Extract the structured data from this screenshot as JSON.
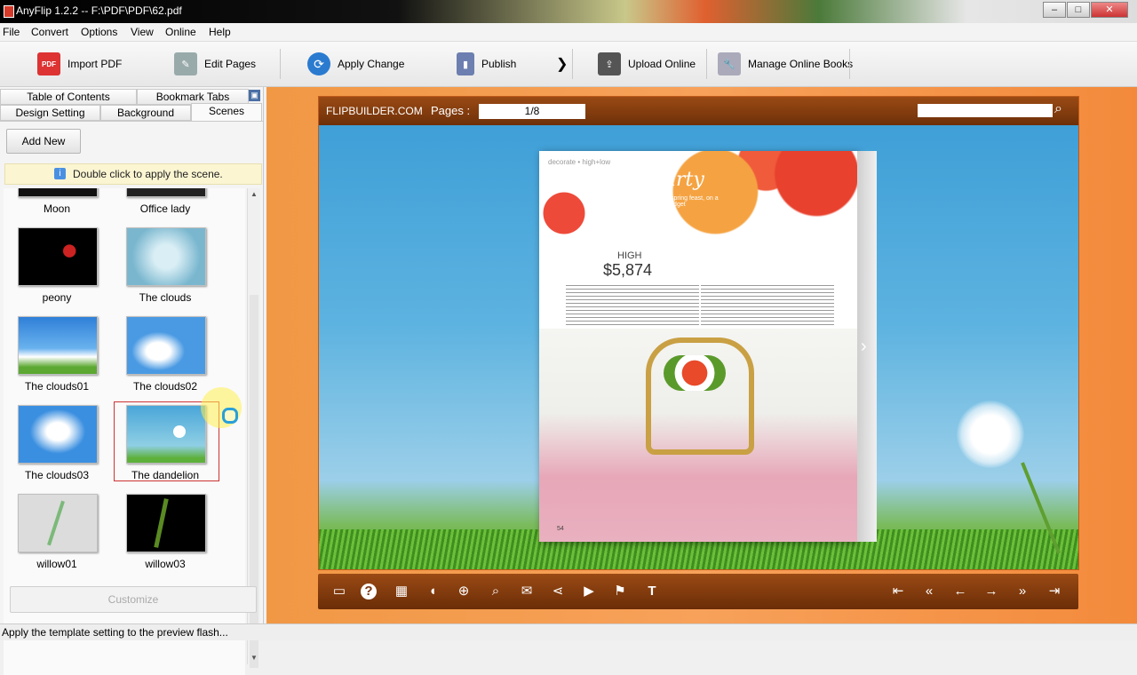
{
  "window": {
    "title": "AnyFlip 1.2.2  -- F:\\PDF\\PDF\\62.pdf",
    "min": "–",
    "max": "□",
    "close": "✕"
  },
  "menu": [
    "File",
    "Convert",
    "Options",
    "View",
    "Online",
    "Help"
  ],
  "toolbar": {
    "import_pdf": "Import PDF",
    "edit_pages": "Edit Pages",
    "apply_change": "Apply Change",
    "publish": "Publish",
    "more": "❯",
    "upload_online": "Upload Online",
    "manage_online_books": "Manage Online Books"
  },
  "left_panel": {
    "tabs_row1": [
      "Table of Contents",
      "Bookmark Tabs"
    ],
    "tabs_row2": [
      "Design Setting",
      "Background",
      "Scenes"
    ],
    "active_tab": "Scenes",
    "add_new": "Add New",
    "hint": "Double click to apply the scene.",
    "scenes": [
      {
        "label": "Moon"
      },
      {
        "label": "Office lady"
      },
      {
        "label": "peony"
      },
      {
        "label": "The clouds"
      },
      {
        "label": "The clouds01"
      },
      {
        "label": "The clouds02"
      },
      {
        "label": "The clouds03"
      },
      {
        "label": "The dandelion",
        "selected": true
      },
      {
        "label": "willow01"
      },
      {
        "label": "willow03"
      }
    ],
    "customize": "Customize"
  },
  "viewer": {
    "brand": "FLIPBUILDER.COM",
    "pages_label": "Pages :",
    "pages_value": "1/8",
    "search_placeholder": "",
    "book": {
      "kicker": "decorate • high+low",
      "headline": "easter party",
      "subhead": "indulge in a sumptuous spring feast, on a champagne or seltzer budget",
      "price_tag": "HIGH",
      "price": "$5,874",
      "page_no": "54"
    }
  },
  "footer_controls": [
    "screen-icon",
    "help-icon",
    "thumbnails-icon",
    "sound-icon",
    "zoom-in-icon",
    "search-icon",
    "email-icon",
    "share-icon",
    "autoplay-icon",
    "bookmark-icon",
    "text-icon",
    "first-page-icon",
    "previous-page-icon",
    "prev-icon",
    "next-icon",
    "next-page-icon",
    "last-page-icon"
  ],
  "status": "Apply the template setting to the preview flash...",
  "colors": {
    "accent_orange": "#f39a4a",
    "viewer_bar": "#7a3510",
    "selection": "#cc3333"
  }
}
